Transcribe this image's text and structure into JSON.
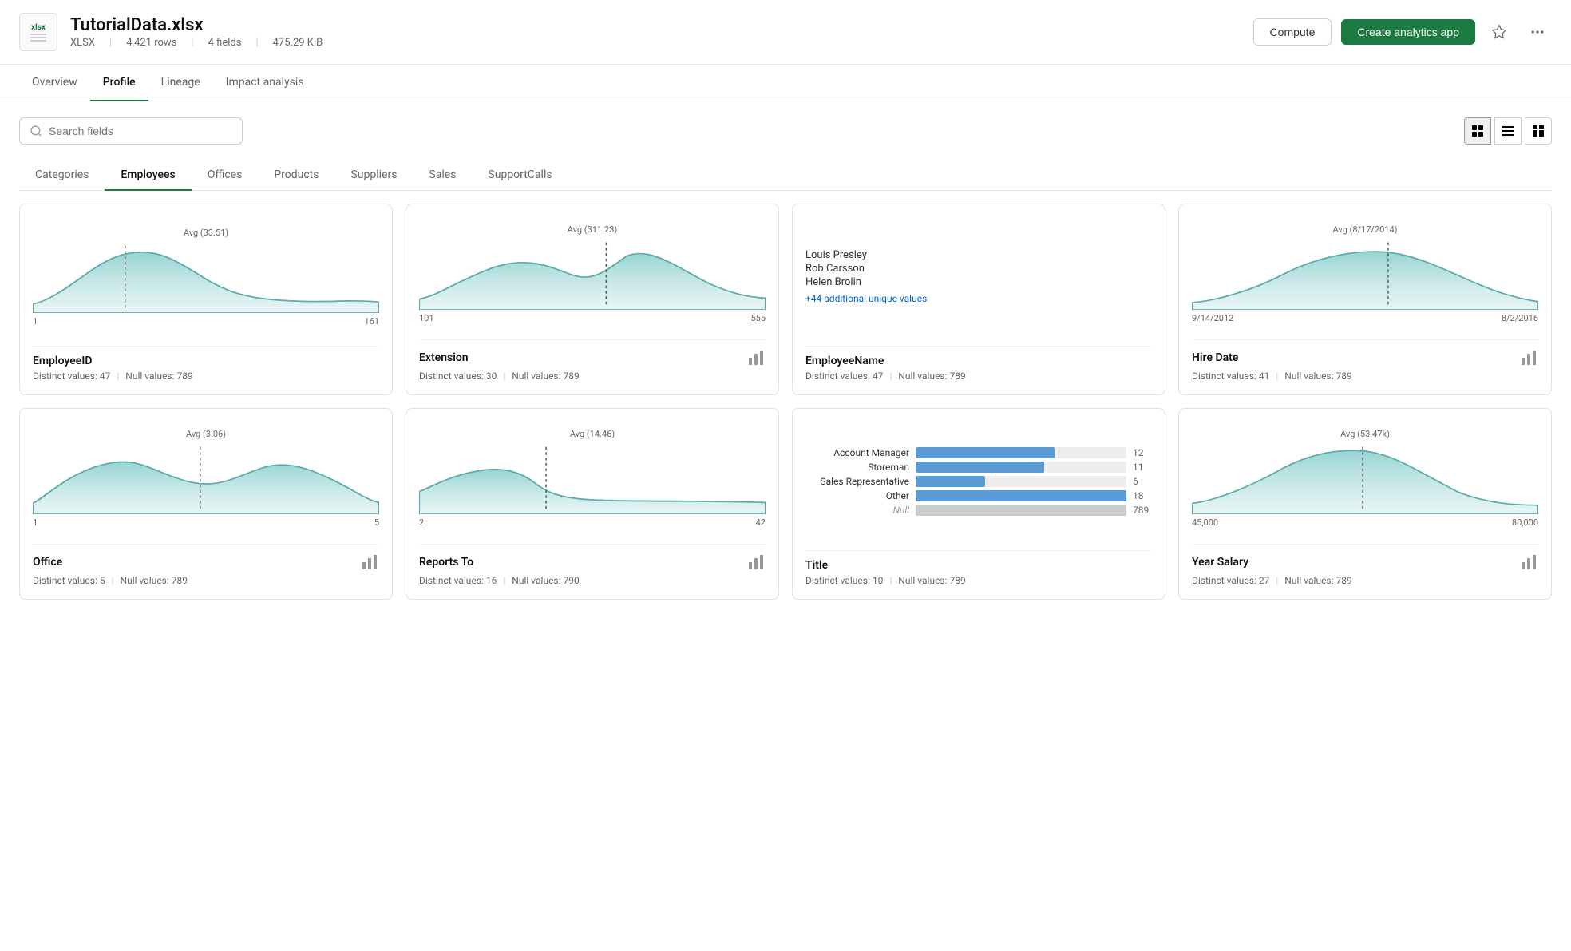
{
  "header": {
    "file_icon_label": "xlsx",
    "file_name": "TutorialData.xlsx",
    "file_type": "XLSX",
    "file_rows": "4,421 rows",
    "file_fields": "4 fields",
    "file_size": "475.29 KiB",
    "btn_compute": "Compute",
    "btn_create": "Create analytics app"
  },
  "tabs": [
    {
      "label": "Overview",
      "active": false
    },
    {
      "label": "Profile",
      "active": true
    },
    {
      "label": "Lineage",
      "active": false
    },
    {
      "label": "Impact analysis",
      "active": false
    }
  ],
  "search": {
    "placeholder": "Search fields"
  },
  "category_tabs": [
    {
      "label": "Categories",
      "active": false
    },
    {
      "label": "Employees",
      "active": true
    },
    {
      "label": "Offices",
      "active": false
    },
    {
      "label": "Products",
      "active": false
    },
    {
      "label": "Suppliers",
      "active": false
    },
    {
      "label": "Sales",
      "active": false
    },
    {
      "label": "SupportCalls",
      "active": false
    }
  ],
  "cards": [
    {
      "id": "employee-id",
      "name": "EmployeeID",
      "type": "distribution",
      "avg_label": "Avg (33.51)",
      "min": "1",
      "max": "161",
      "distinct": "47",
      "null_values": "789",
      "has_chart_icon": false
    },
    {
      "id": "extension",
      "name": "Extension",
      "type": "distribution",
      "avg_label": "Avg (311.23)",
      "min": "101",
      "max": "555",
      "distinct": "30",
      "null_values": "789",
      "has_chart_icon": true
    },
    {
      "id": "employee-name",
      "name": "EmployeeName",
      "type": "names",
      "names": [
        "Louis Presley",
        "Rob Carsson",
        "Helen Brolin"
      ],
      "more_label": "+44 additional unique values",
      "distinct": "47",
      "null_values": "789",
      "has_chart_icon": false
    },
    {
      "id": "hire-date",
      "name": "Hire Date",
      "type": "distribution",
      "avg_label": "Avg (8/17/2014)",
      "min": "9/14/2012",
      "max": "8/2/2016",
      "distinct": "41",
      "null_values": "789",
      "has_chart_icon": true
    },
    {
      "id": "office",
      "name": "Office",
      "type": "distribution2",
      "avg_label": "Avg (3.06)",
      "min": "1",
      "max": "5",
      "distinct": "5",
      "null_values": "789",
      "has_chart_icon": true
    },
    {
      "id": "reports-to",
      "name": "Reports To",
      "type": "distribution3",
      "avg_label": "Avg (14.46)",
      "min": "2",
      "max": "42",
      "distinct": "16",
      "null_values": "790",
      "has_chart_icon": true
    },
    {
      "id": "title",
      "name": "Title",
      "type": "bars",
      "bars": [
        {
          "label": "Account Manager",
          "value": 12,
          "max": 18,
          "null": false
        },
        {
          "label": "Storeman",
          "value": 11,
          "max": 18,
          "null": false
        },
        {
          "label": "Sales Representative",
          "value": 6,
          "max": 18,
          "null": false
        },
        {
          "label": "Other",
          "value": 18,
          "max": 18,
          "null": false
        },
        {
          "label": "Null",
          "value": 789,
          "max": 789,
          "null": true
        }
      ],
      "distinct": "10",
      "null_values": "789",
      "has_chart_icon": false
    },
    {
      "id": "year-salary",
      "name": "Year Salary",
      "type": "distribution4",
      "avg_label": "Avg (53.47k)",
      "min": "45,000",
      "max": "80,000",
      "distinct": "27",
      "null_values": "789",
      "has_chart_icon": true
    }
  ]
}
